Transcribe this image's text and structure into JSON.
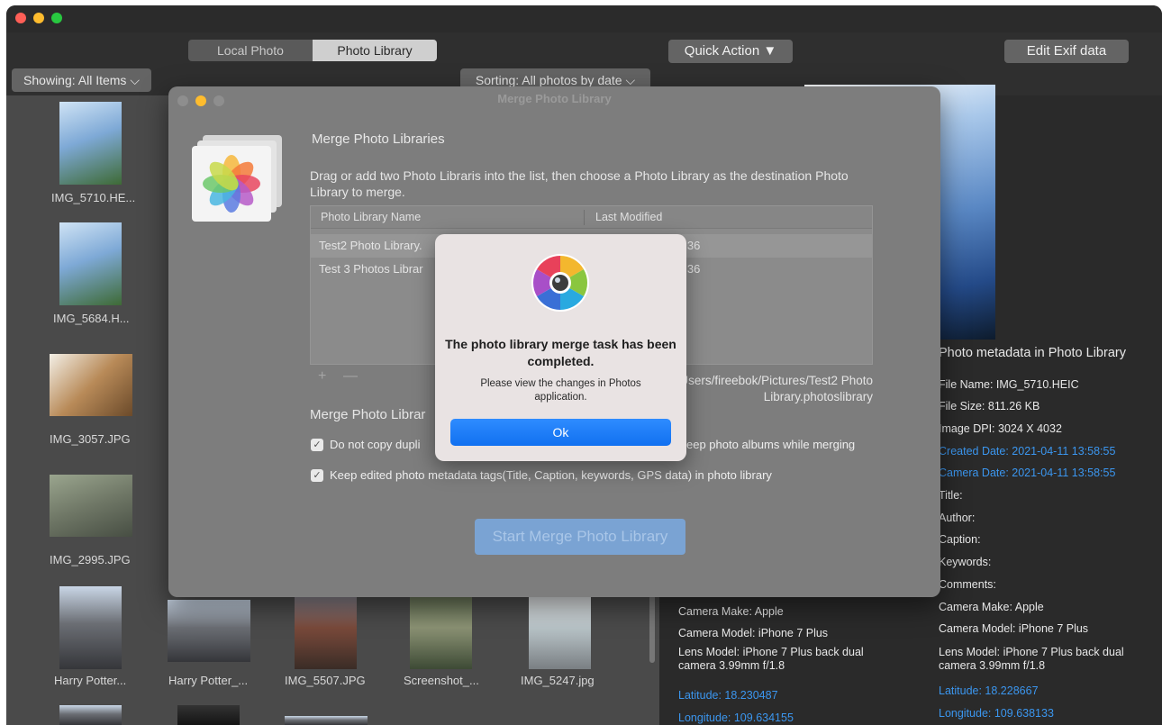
{
  "toolbar": {
    "segments": [
      "Local Photo",
      "Photo Library"
    ],
    "quick_action": "Quick Action ▼",
    "edit_exif": "Edit Exif data",
    "showing": "Showing: All Items ⌵",
    "sorting": "Sorting: All photos by date ⌵"
  },
  "thumbs": {
    "t1": "IMG_5710.HE...",
    "t2": "IMG_5684.H...",
    "t3": "IMG_3057.JPG",
    "t4": "IMG_2995.JPG",
    "row_bottom": [
      "Harry Potter...",
      "Harry Potter_...",
      "IMG_5507.JPG",
      "Screenshot_...",
      "IMG_5247.jpg"
    ]
  },
  "metadata": {
    "heading": "Photo metadata in Photo Library",
    "file_name": "File Name: IMG_5710.HEIC",
    "file_size": "File Size: 811.26 KB",
    "image_dpi": "Image DPI: 3024 X 4032",
    "created_date": "Created Date: 2021-04-11 13:58:55",
    "camera_date": "Camera Date: 2021-04-11 13:58:55",
    "title": "Title:",
    "author": "Author:",
    "caption": "Caption:",
    "keywords": "Keywords:",
    "comments": "Comments:",
    "camera_make": "Camera Make: Apple",
    "camera_model": "Camera Model: iPhone 7 Plus",
    "lens_model": "Lens Model: iPhone 7 Plus back dual camera 3.99mm f/1.8",
    "latitude": "Latitude: 18.228667",
    "longitude": "Longitude: 109.638133"
  },
  "metadata_local": {
    "camera_make": "Camera Make: Apple",
    "camera_model": "Camera Model: iPhone 7 Plus",
    "lens_model": "Lens Model: iPhone 7 Plus back dual camera 3.99mm f/1.8",
    "latitude": "Latitude: 18.230487",
    "longitude": "Longitude: 109.634155"
  },
  "merge": {
    "window_title": "Merge Photo Library",
    "heading": "Merge Photo Libraries",
    "description": "Drag or add two Photo Libraris into the list, then choose a Photo Library as the destination Photo Library to merge.",
    "col_name": "Photo Library Name",
    "col_modified": "Last Modified",
    "rows": [
      {
        "name": "Test2 Photo Library.",
        "modified": "4:36"
      },
      {
        "name": "Test 3 Photos Librar",
        "modified": "4:36"
      }
    ],
    "plus": "+",
    "minus": "—",
    "path": "Users/fireebok/Pictures/Test2 Photo Library.photoslibrary",
    "options_heading": "Merge Photo Librar",
    "opt_duplicates": "Do not copy dupli",
    "opt_albums": "eep photo albums while merging",
    "opt_metadata": "Keep edited photo metadata tags(Title, Caption, keywords, GPS data) in photo library",
    "check": "✓",
    "start_button": "Start Merge Photo Library"
  },
  "alert": {
    "title": "The photo library merge task has been completed.",
    "message": "Please view the changes in Photos application.",
    "ok": "Ok"
  }
}
